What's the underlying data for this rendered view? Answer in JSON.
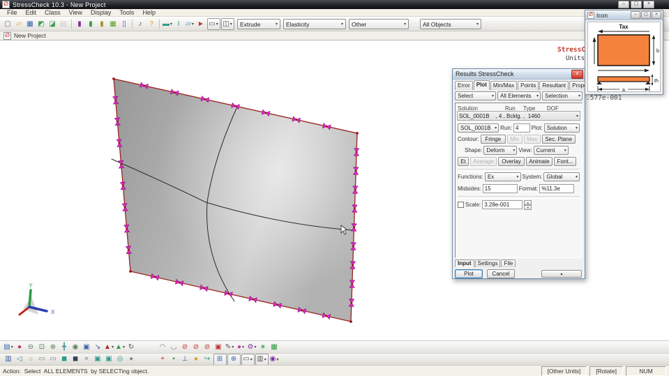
{
  "window": {
    "title": "StressCheck 10.3 - New Project"
  },
  "glyphs": {
    "logo": "∅",
    "min": "–",
    "max": "▢",
    "close": "×",
    "spin_up": "▴",
    "spin_down": "▾",
    "tab_left": "◂",
    "tab_right": "▸",
    "expand": "▴"
  },
  "menubar": {
    "items": [
      "File",
      "Edit",
      "Class",
      "View",
      "Display",
      "Tools",
      "Help"
    ]
  },
  "toolbar_top": {
    "combos": [
      {
        "label": "Extrude"
      },
      {
        "label": "Elasticity"
      },
      {
        "label": "Other"
      },
      {
        "label": "All Objects"
      }
    ],
    "icons": [
      {
        "name": "new-file",
        "glyph": "▢",
        "color": "#6b6b6b"
      },
      {
        "name": "open-folder",
        "glyph": "▱",
        "color": "#d8a23a"
      },
      {
        "name": "save",
        "glyph": "▦",
        "color": "#3a62aa"
      },
      {
        "name": "import-model",
        "glyph": "◩",
        "color": "#3f9a4f"
      },
      {
        "name": "export-model",
        "glyph": "◪",
        "color": "#3f9a4f"
      },
      {
        "name": "print",
        "glyph": "▤",
        "color": "#9a9a9a",
        "disabled": true
      },
      {
        "sep": true
      },
      {
        "name": "database-main",
        "glyph": "▮",
        "color": "#7d2fa0"
      },
      {
        "name": "database-green",
        "glyph": "▮",
        "color": "#2f9a45"
      },
      {
        "name": "database-olive",
        "glyph": "▮",
        "color": "#9a9a25"
      },
      {
        "name": "mesh-check",
        "glyph": "▦",
        "color": "#58a020"
      },
      {
        "name": "database-mini",
        "glyph": "▯",
        "color": "#7d2fa0"
      },
      {
        "sep": true
      },
      {
        "name": "sound",
        "glyph": "♪",
        "color": "#555555"
      },
      {
        "name": "help",
        "glyph": "?",
        "color": "#caa520"
      },
      {
        "sep": true
      },
      {
        "name": "material-select",
        "glyph": "▬",
        "color": "#2f9a8a",
        "dropdown": true
      },
      {
        "name": "beam-tool",
        "glyph": "Ι",
        "color": "#2f9a8a"
      },
      {
        "name": "layer-folder",
        "glyph": "▱",
        "color": "#3a7ab8",
        "dropdown": true
      },
      {
        "name": "run-pointer",
        "glyph": "►",
        "color": "#c03030"
      },
      {
        "name": "select-mode",
        "glyph": "▭",
        "color": "#555555",
        "boxed": true,
        "dropdown": true
      },
      {
        "name": "pick-mode",
        "glyph": "◫",
        "color": "#555555",
        "boxed": true,
        "dropdown": true
      }
    ]
  },
  "project_tab": {
    "label": "New Project"
  },
  "viewport": {
    "annotations": {
      "line1": "StressC",
      "line2": "Units",
      "value": ".577e-001"
    },
    "axis": {
      "x_label": "X",
      "y_label": "Y"
    },
    "colors": {
      "bc_symbol": "#e326c8",
      "bc_stroke": "#8a0a74",
      "edge": "#9c2020",
      "dot": "#a01818",
      "curve": "#2a2a2a"
    },
    "plate": {
      "corners": [
        [
          163,
          55
        ],
        [
          512,
          133
        ],
        [
          503,
          403
        ],
        [
          187,
          331
        ]
      ],
      "edge_symbol_counts": [
        7,
        9,
        8,
        8
      ]
    },
    "curves": [
      "M160,170 Q238,204 295,232 Q402,264 505,272",
      "M340,95 Q306,170 297,232 Q292,310 336,374"
    ]
  },
  "results_dialog": {
    "title": "Results StressCheck",
    "tabs": [
      "Error",
      "Plot",
      "Min/Max",
      "Points",
      "Resultant",
      "Prope:"
    ],
    "selects": {
      "extraction": "Select",
      "objects": "All Elements",
      "method": "Selection"
    },
    "solution_list": {
      "headers": [
        "Solution",
        "Run",
        "Type",
        "DOF"
      ],
      "entry": "SOL_0001B    , 4 , Bcklg. ,  1460"
    },
    "solution_row": {
      "solution": "SOL_0001B",
      "run_label": "Run:",
      "run_value": "4",
      "plot_label": "Plot:",
      "plot_value": "Solution"
    },
    "contour": {
      "label": "Contour:",
      "fringe": "Fringe",
      "min": "Min",
      "max": "Max",
      "sec_plane": "Sec. Plane"
    },
    "shape": {
      "label": "Shape:",
      "value": "Deform",
      "view_label": "View:",
      "view_value": "Current"
    },
    "action_buttons": {
      "et": "Et",
      "average": "Average",
      "overlay": "Overlay",
      "animate": "Animate",
      "font": "Font..."
    },
    "functions": {
      "label": "Functions:",
      "value": "Ex",
      "system_label": "System:",
      "system_value": "Global"
    },
    "midsides": {
      "label": "Midsides:",
      "value": "15",
      "format_label": "Format:",
      "format_value": "%11.3e"
    },
    "scale": {
      "label": "Scale:",
      "value": "3.28e-001"
    },
    "bottom_tabs": [
      "Input",
      "Settings",
      "File"
    ],
    "buttons": {
      "plot": "Plot",
      "cancel": "Cancel"
    }
  },
  "icon_window": {
    "title": "Icon",
    "fill": "#f5823c",
    "labels": {
      "top": "Tax",
      "height": "b",
      "thickness": "th",
      "width": "a"
    }
  },
  "toolbar_bottom1": {
    "icons": [
      {
        "name": "view-preset",
        "glyph": "▤",
        "color": "#3a62aa",
        "dropdown": true
      },
      {
        "name": "render-ball",
        "glyph": "●",
        "color": "#c03060"
      },
      {
        "name": "zoom-out",
        "glyph": "⊖",
        "color": "#557f55"
      },
      {
        "name": "zoom-window",
        "glyph": "⊡",
        "color": "#557f55"
      },
      {
        "name": "zoom-in",
        "glyph": "⊕",
        "color": "#557f55"
      },
      {
        "name": "pan",
        "glyph": "╋",
        "color": "#3a8a9a"
      },
      {
        "name": "zoom-dynamic",
        "glyph": "◉",
        "color": "#557f55"
      },
      {
        "name": "fit-view",
        "glyph": "▣",
        "color": "#3a62aa"
      },
      {
        "name": "resize-view",
        "glyph": "↘",
        "color": "#3a62aa"
      },
      {
        "name": "rotate-red",
        "glyph": "▲",
        "color": "#b02020",
        "dropdown": true
      },
      {
        "name": "rotate-green",
        "glyph": "▲",
        "color": "#2f9a45",
        "dropdown": true
      },
      {
        "name": "rotate-view",
        "glyph": "↻",
        "color": "#555555"
      },
      {
        "sep": true,
        "wide": true
      },
      {
        "name": "undo-view",
        "glyph": "◠",
        "color": "#777777"
      },
      {
        "name": "redo-view",
        "glyph": "◡",
        "color": "#777777"
      },
      {
        "name": "hide-loads",
        "glyph": "⊘",
        "color": "#c03030"
      },
      {
        "name": "hide-constraints",
        "glyph": "⊘",
        "color": "#c03030"
      },
      {
        "name": "hide-attributes",
        "glyph": "⊘",
        "color": "#c03030"
      },
      {
        "name": "show-frame",
        "glyph": "▣",
        "color": "#c03030"
      },
      {
        "name": "draw-tool",
        "glyph": "✎",
        "color": "#555555",
        "dropdown": true
      },
      {
        "name": "point-tool",
        "glyph": "●",
        "color": "#c040a0",
        "dropdown": true
      },
      {
        "name": "options-gear",
        "glyph": "⚙",
        "color": "#7d2fa0",
        "dropdown": true
      },
      {
        "name": "snap-tool",
        "glyph": "∗",
        "color": "#2f9a45"
      },
      {
        "name": "grid-tool",
        "glyph": "▦",
        "color": "#2f9a45"
      }
    ]
  },
  "toolbar_bottom2": {
    "icons": [
      {
        "name": "mini-plot",
        "glyph": "▥",
        "color": "#3a62aa"
      },
      {
        "name": "prev-view",
        "glyph": "◁",
        "color": "#3a8a9a"
      },
      {
        "name": "light-toggle",
        "glyph": "☼",
        "color": "#d8a020"
      },
      {
        "name": "sheet-one",
        "glyph": "▭",
        "color": "#808080"
      },
      {
        "name": "sheet-two",
        "glyph": "▭",
        "color": "#808080"
      },
      {
        "name": "fill-teal",
        "glyph": "◼",
        "color": "#2f9a8a"
      },
      {
        "name": "fill-dark",
        "glyph": "◼",
        "color": "#38405a"
      },
      {
        "name": "clear-small",
        "glyph": "×",
        "color": "#777777"
      },
      {
        "name": "frame-a",
        "glyph": "▣",
        "color": "#2f9a8a"
      },
      {
        "name": "frame-b",
        "glyph": "▣",
        "color": "#2f9a8a"
      },
      {
        "name": "frame-globe",
        "glyph": "◎",
        "color": "#2f9a8a"
      },
      {
        "name": "sphere-gray",
        "glyph": "●",
        "color": "#8a8a8a"
      },
      {
        "sep": true,
        "wide": true
      },
      {
        "name": "axis-cross",
        "glyph": "+",
        "color": "#c03030"
      },
      {
        "name": "node-green",
        "glyph": "▪",
        "color": "#2f9a45"
      },
      {
        "name": "axis-tee",
        "glyph": "⊥",
        "color": "#3a62aa"
      },
      {
        "name": "sphere-yellow",
        "glyph": "●",
        "color": "#d8a020"
      },
      {
        "name": "flow-arrow",
        "glyph": "↪",
        "color": "#2f9a8a"
      },
      {
        "name": "grid-frame",
        "glyph": "⊞",
        "color": "#3a62aa",
        "boxed": true
      },
      {
        "name": "target-frame",
        "glyph": "⊕",
        "color": "#3a62aa",
        "boxed": true
      },
      {
        "name": "display-mode",
        "glyph": "▭",
        "color": "#555555",
        "boxed": true,
        "dropdown": true
      },
      {
        "name": "format-grid",
        "glyph": "▥",
        "color": "#555555",
        "boxed": true,
        "dropdown": true
      },
      {
        "name": "globe-system",
        "glyph": "◉",
        "color": "#7d2fa0",
        "dropdown": true
      }
    ]
  },
  "statusbar": {
    "action": "Action:  Select  ALL ELEMENTS  by SELECTing object.",
    "right": [
      "[Other Units]",
      "[Rotate]",
      "NUM"
    ]
  }
}
